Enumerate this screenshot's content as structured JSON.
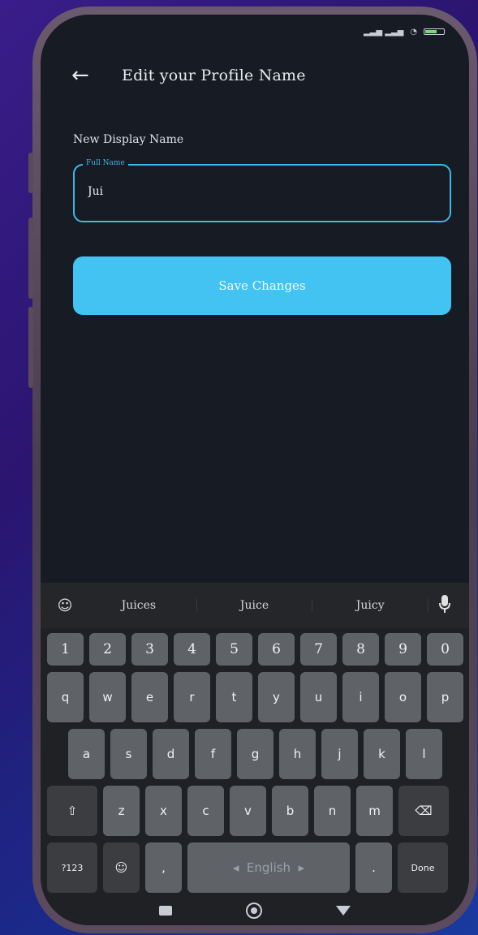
{
  "header": {
    "back_icon": "arrow-left-icon",
    "title": "Edit your Profile Name"
  },
  "form": {
    "section_label": "New Display Name",
    "field_label": "Full Name",
    "field_value": "Jui",
    "save_label": "Save Changes"
  },
  "colors": {
    "accent": "#42c3f2",
    "background": "#161b24",
    "field_border": "#3fb8e8"
  },
  "keyboard": {
    "suggestions": [
      "Juices",
      "Juice",
      "Juicy"
    ],
    "numbers": [
      "1",
      "2",
      "3",
      "4",
      "5",
      "6",
      "7",
      "8",
      "9",
      "0"
    ],
    "row1": [
      "q",
      "w",
      "e",
      "r",
      "t",
      "y",
      "u",
      "i",
      "o",
      "p"
    ],
    "row2": [
      "a",
      "s",
      "d",
      "f",
      "g",
      "h",
      "j",
      "k",
      "l"
    ],
    "row3": [
      "z",
      "x",
      "c",
      "v",
      "b",
      "n",
      "m"
    ],
    "sym_label": "?123",
    "space_label": "English",
    "comma": ",",
    "period": ".",
    "done_label": "Done"
  }
}
